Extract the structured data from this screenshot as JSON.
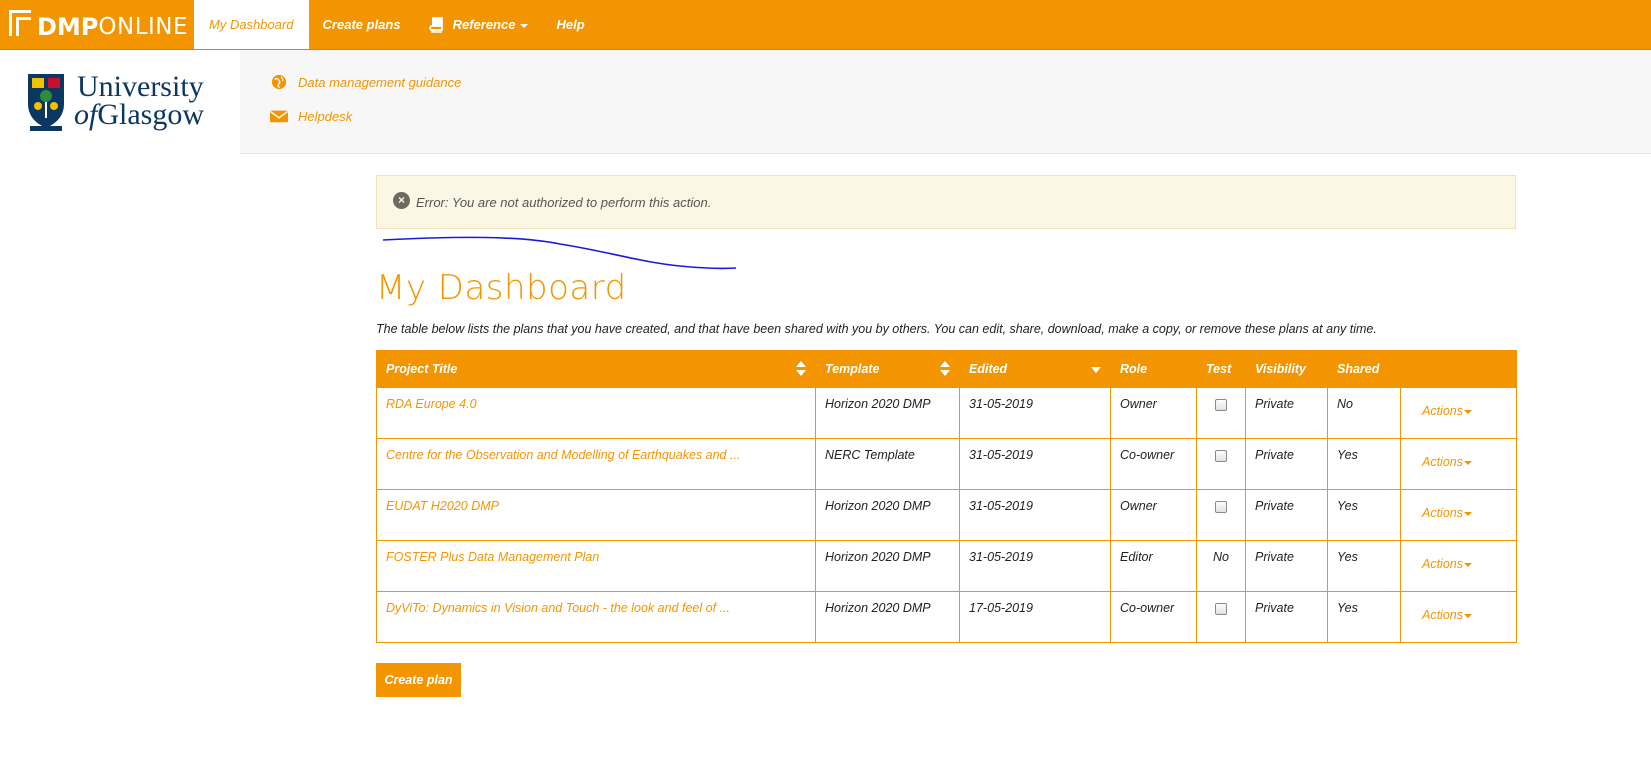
{
  "brand": {
    "part1": "DMP",
    "part2": "ONLINE"
  },
  "nav": {
    "dashboard": "My Dashboard",
    "create_plans": "Create plans",
    "reference": "Reference",
    "help": "Help"
  },
  "org": {
    "name_line1": "University",
    "name_line2_prefix": "of",
    "name_line2_rest": "Glasgow",
    "links": [
      "Data management guidance",
      "Helpdesk"
    ]
  },
  "alert": {
    "message": "Error: You are not authorized to perform this action."
  },
  "page": {
    "title": "My Dashboard",
    "intro": "The table below lists the plans that you have created, and that have been shared with you by others. You can edit, share, download, make a copy, or remove these plans at any time."
  },
  "table": {
    "headers": [
      "Project Title",
      "Template",
      "Edited",
      "Role",
      "Test",
      "Visibility",
      "Shared",
      ""
    ],
    "actions_label": "Actions",
    "rows": [
      {
        "title": "RDA Europe 4.0",
        "template": "Horizon 2020 DMP",
        "edited": "31-05-2019",
        "role": "Owner",
        "test": "",
        "visibility": "Private",
        "shared": "No"
      },
      {
        "title": "Centre for the Observation and Modelling of Earthquakes and ...",
        "template": "NERC Template",
        "edited": "31-05-2019",
        "role": "Co-owner",
        "test": "",
        "visibility": "Private",
        "shared": "Yes"
      },
      {
        "title": "EUDAT H2020 DMP",
        "template": "Horizon 2020 DMP",
        "edited": "31-05-2019",
        "role": "Owner",
        "test": "",
        "visibility": "Private",
        "shared": "Yes"
      },
      {
        "title": "FOSTER Plus Data Management Plan",
        "template": "Horizon 2020 DMP",
        "edited": "31-05-2019",
        "role": "Editor",
        "test": "No",
        "visibility": "Private",
        "shared": "Yes"
      },
      {
        "title": "DyViTo: Dynamics in Vision and Touch - the look and feel of ...",
        "template": "Horizon 2020 DMP",
        "edited": "17-05-2019",
        "role": "Co-owner",
        "test": "",
        "visibility": "Private",
        "shared": "Yes"
      }
    ]
  },
  "create_button": "Create plan",
  "colors": {
    "accent": "#f39500",
    "alert_bg": "#fcf6e4",
    "org_blue": "#0b3760",
    "annotation": "#1a1adc"
  }
}
